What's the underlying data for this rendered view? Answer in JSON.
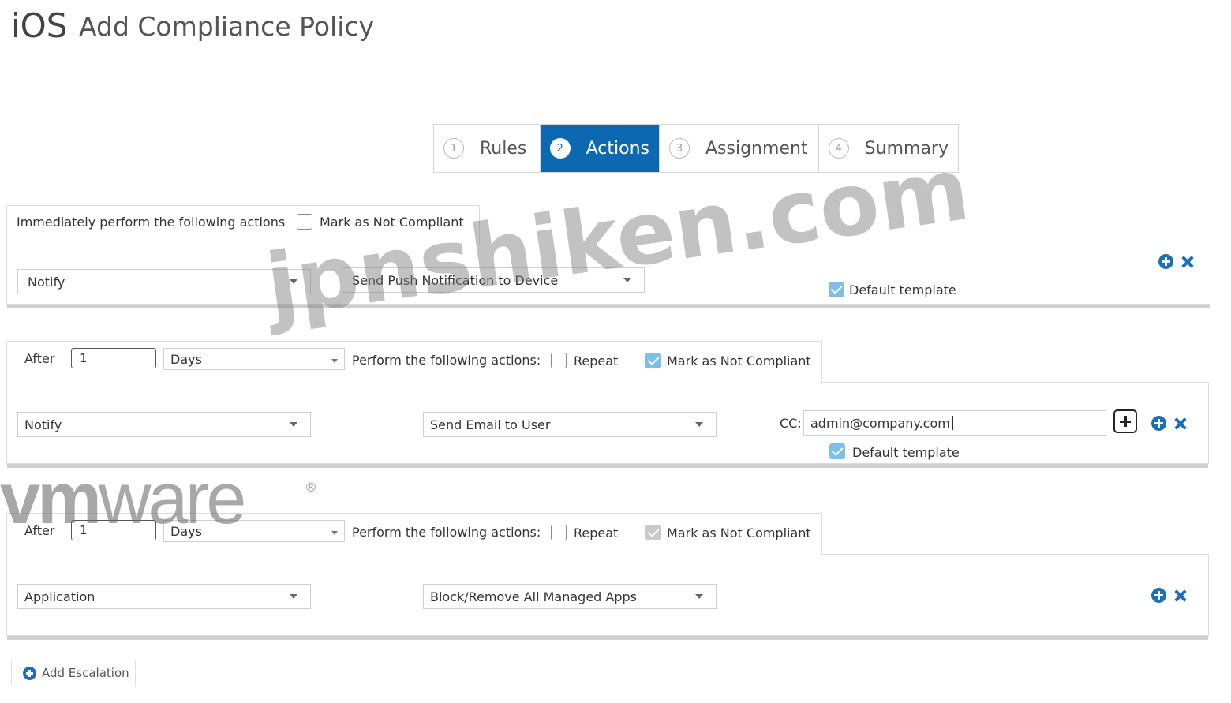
{
  "header": {
    "os_label": "iOS",
    "title": "Add Compliance Policy"
  },
  "wizard": {
    "steps": [
      {
        "number": "1",
        "label": "Rules",
        "active": false
      },
      {
        "number": "2",
        "label": "Actions",
        "active": true
      },
      {
        "number": "3",
        "label": "Assignment",
        "active": false
      },
      {
        "number": "4",
        "label": "Summary",
        "active": false
      }
    ]
  },
  "immediate": {
    "heading": "Immediately perform the following actions",
    "mark_not_compliant_label": "Mark as Not Compliant",
    "mark_not_compliant_checked": false,
    "action_type": "Notify",
    "action_detail": "Send Push Notification to Device",
    "default_template_label": "Default template",
    "default_template_checked": true
  },
  "escalations": [
    {
      "after_label": "After",
      "after_value": "1",
      "unit": "Days",
      "perform_label": "Perform the following actions:",
      "repeat_label": "Repeat",
      "repeat_checked": false,
      "mark_not_compliant_label": "Mark as Not Compliant",
      "mark_not_compliant_checked": true,
      "action_type": "Notify",
      "action_detail": "Send Email to User",
      "cc_label": "CC:",
      "cc_value": "admin@company.com",
      "default_template_label": "Default template",
      "default_template_checked": true
    },
    {
      "after_label": "After",
      "after_value": "1",
      "unit": "Days",
      "perform_label": "Perform the following actions:",
      "repeat_label": "Repeat",
      "repeat_checked": false,
      "mark_not_compliant_label": "Mark as Not Compliant",
      "mark_not_compliant_checked": true,
      "action_type": "Application",
      "action_detail": "Block/Remove All Managed Apps"
    }
  ],
  "add_escalation_label": "Add Escalation",
  "watermarks": {
    "site": "jpnshiken.com",
    "vm_light": "vm",
    "vm_rest": "ware",
    "reg": "®"
  },
  "colors": {
    "accent": "#0c68b1",
    "icon_blue": "#1d6fb8",
    "checkbox_blue": "#7cc0ea"
  }
}
